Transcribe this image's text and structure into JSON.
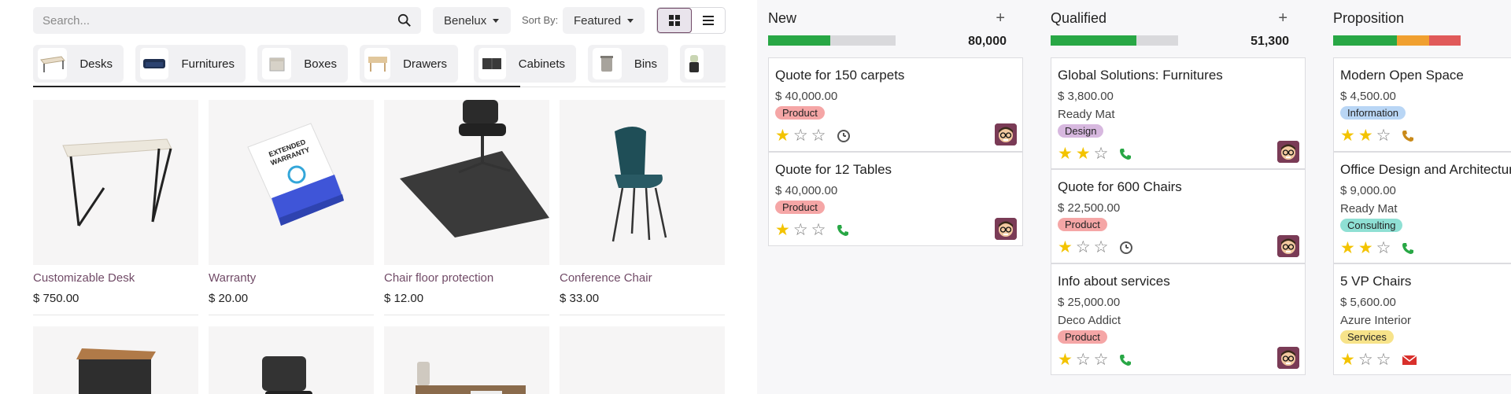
{
  "shop": {
    "search_placeholder": "Search...",
    "pricelist": "Benelux",
    "sort_label": "Sort By:",
    "sort_value": "Featured",
    "categories": [
      {
        "label": "Desks"
      },
      {
        "label": "Furnitures"
      },
      {
        "label": "Boxes"
      },
      {
        "label": "Drawers"
      },
      {
        "label": "Cabinets"
      },
      {
        "label": "Bins"
      }
    ],
    "products": [
      {
        "name": "Customizable Desk",
        "price": "$ 750.00"
      },
      {
        "name": "Warranty",
        "price": "$ 20.00",
        "box_text": "EXTENDED WARRANTY"
      },
      {
        "name": "Chair floor protection",
        "price": "$ 12.00"
      },
      {
        "name": "Conference Chair",
        "price": "$ 33.00"
      }
    ]
  },
  "kanban": {
    "columns": [
      {
        "title": "New",
        "total": "80,000",
        "progress": [
          {
            "color": "#28a745",
            "value": 0.49
          }
        ],
        "cards": [
          {
            "title": "Quote for 150 carpets",
            "amount": "$ 40,000.00",
            "customer": "",
            "tag": "Product",
            "tag_color": "#f5a6a6",
            "stars": 1,
            "activity": "clock-icon"
          },
          {
            "title": "Quote for 12 Tables",
            "amount": "$ 40,000.00",
            "customer": "",
            "tag": "Product",
            "tag_color": "#f5a6a6",
            "stars": 1,
            "activity": "phone-icon"
          }
        ]
      },
      {
        "title": "Qualified",
        "total": "51,300",
        "progress": [
          {
            "color": "#28a745",
            "value": 0.67
          }
        ],
        "cards": [
          {
            "title": "Global Solutions: Furnitures",
            "amount": "$ 3,800.00",
            "customer": "Ready Mat",
            "tag": "Design",
            "tag_color": "#d7b8df",
            "stars": 2,
            "activity": "phone-icon"
          },
          {
            "title": "Quote for 600 Chairs",
            "amount": "$ 22,500.00",
            "customer": "",
            "tag": "Product",
            "tag_color": "#f5a6a6",
            "stars": 1,
            "activity": "clock-icon"
          },
          {
            "title": "Info about services",
            "amount": "$ 25,000.00",
            "customer": "Deco Addict",
            "tag": "Product",
            "tag_color": "#f5a6a6",
            "stars": 1,
            "activity": "phone-icon"
          }
        ]
      },
      {
        "title": "Proposition",
        "total": "",
        "progress": [
          {
            "color": "#28a745",
            "value": 0.5
          },
          {
            "color": "#f0a030",
            "value": 0.25
          },
          {
            "color": "#e05a5a",
            "value": 0.25
          }
        ],
        "cards": [
          {
            "title": "Modern Open Space",
            "amount": "$ 4,500.00",
            "customer": "",
            "tag": "Information",
            "tag_color": "#b9d6f5",
            "stars": 2,
            "activity": "phone-icon-orange"
          },
          {
            "title": "Office Design and Architecture",
            "amount": "$ 9,000.00",
            "customer": "Ready Mat",
            "tag": "Consulting",
            "tag_color": "#8fe0d4",
            "stars": 2,
            "activity": "phone-icon"
          },
          {
            "title": "5 VP Chairs",
            "amount": "$ 5,600.00",
            "customer": "Azure Interior",
            "tag": "Services",
            "tag_color": "#f7e38a",
            "stars": 1,
            "activity": "envelope-icon"
          }
        ]
      }
    ]
  }
}
